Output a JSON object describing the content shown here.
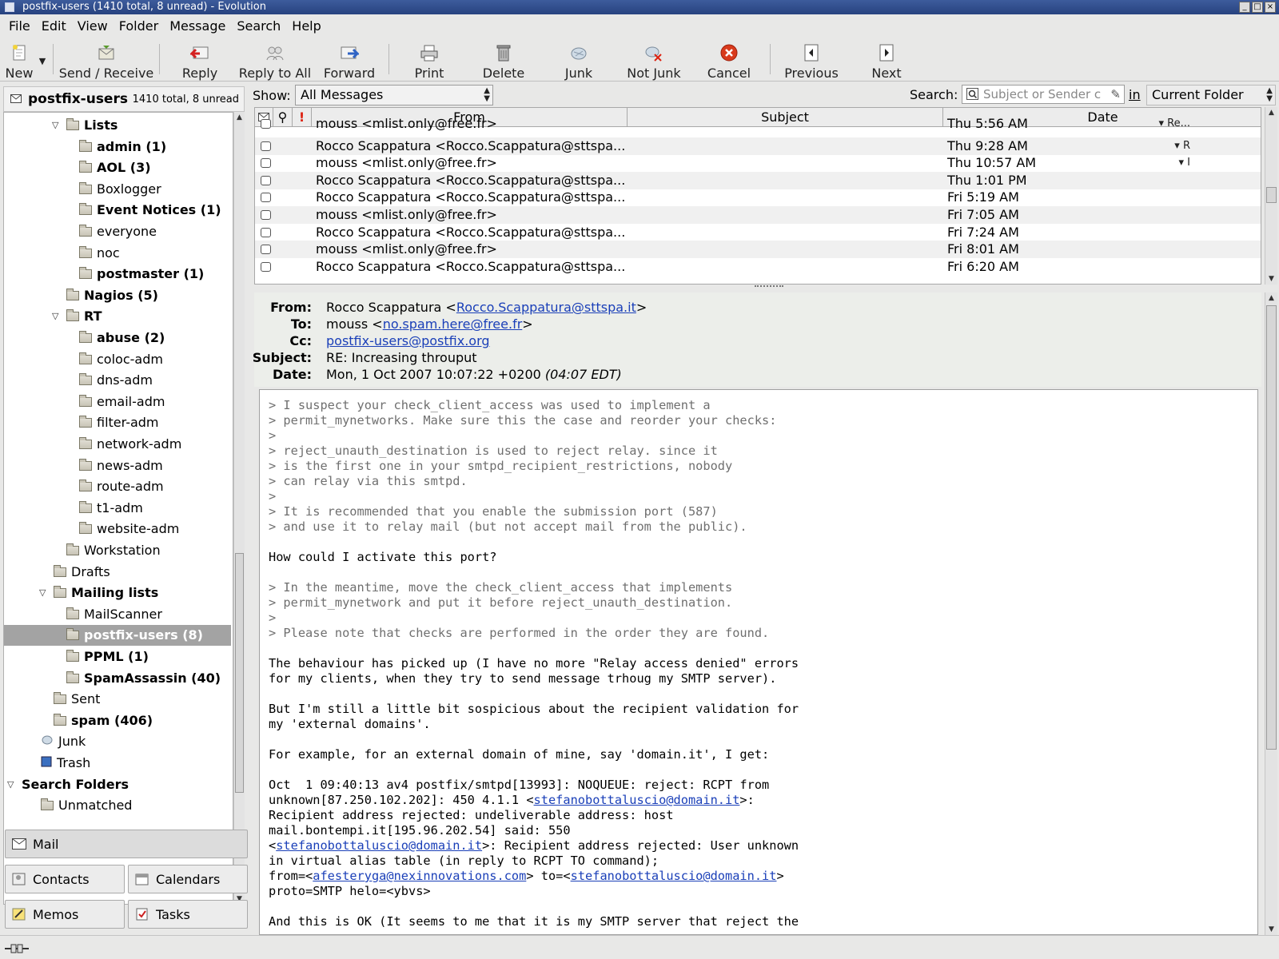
{
  "window": {
    "title": "postfix-users (1410 total, 8 unread) - Evolution"
  },
  "menu": [
    "File",
    "Edit",
    "View",
    "Folder",
    "Message",
    "Search",
    "Help"
  ],
  "toolbar": {
    "new": "New",
    "send_receive": "Send / Receive",
    "reply": "Reply",
    "reply_all": "Reply to All",
    "forward": "Forward",
    "print": "Print",
    "delete": "Delete",
    "junk": "Junk",
    "not_junk": "Not Junk",
    "cancel": "Cancel",
    "previous": "Previous",
    "next": "Next"
  },
  "account": {
    "name": "postfix-users",
    "counts": "1410 total, 8 unread"
  },
  "folders": [
    {
      "label": "Lists",
      "bold": true,
      "level": 3,
      "arrow": "open"
    },
    {
      "label": "admin (1)",
      "bold": true,
      "level": 4
    },
    {
      "label": "AOL (3)",
      "bold": true,
      "level": 4
    },
    {
      "label": "Boxlogger",
      "bold": false,
      "level": 4
    },
    {
      "label": "Event Notices (1)",
      "bold": true,
      "level": 4
    },
    {
      "label": "everyone",
      "bold": false,
      "level": 4
    },
    {
      "label": "noc",
      "bold": false,
      "level": 4
    },
    {
      "label": "postmaster (1)",
      "bold": true,
      "level": 4
    },
    {
      "label": "Nagios (5)",
      "bold": true,
      "level": 3
    },
    {
      "label": "RT",
      "bold": true,
      "level": 3,
      "arrow": "open"
    },
    {
      "label": "abuse (2)",
      "bold": true,
      "level": 4
    },
    {
      "label": "coloc-adm",
      "bold": false,
      "level": 4
    },
    {
      "label": "dns-adm",
      "bold": false,
      "level": 4
    },
    {
      "label": "email-adm",
      "bold": false,
      "level": 4
    },
    {
      "label": "filter-adm",
      "bold": false,
      "level": 4
    },
    {
      "label": "network-adm",
      "bold": false,
      "level": 4
    },
    {
      "label": "news-adm",
      "bold": false,
      "level": 4
    },
    {
      "label": "route-adm",
      "bold": false,
      "level": 4
    },
    {
      "label": "t1-adm",
      "bold": false,
      "level": 4
    },
    {
      "label": "website-adm",
      "bold": false,
      "level": 4
    },
    {
      "label": "Workstation",
      "bold": false,
      "level": 3
    },
    {
      "label": "Drafts",
      "bold": false,
      "level": 2
    },
    {
      "label": "Mailing lists",
      "bold": true,
      "level": 2,
      "arrow": "open"
    },
    {
      "label": "MailScanner",
      "bold": false,
      "level": 3
    },
    {
      "label": "postfix-users (8)",
      "bold": true,
      "level": 3,
      "selected": true
    },
    {
      "label": "PPML (1)",
      "bold": true,
      "level": 3
    },
    {
      "label": "SpamAssassin (40)",
      "bold": true,
      "level": 3
    },
    {
      "label": "Sent",
      "bold": false,
      "level": 2
    },
    {
      "label": "spam (406)",
      "bold": true,
      "level": 2
    },
    {
      "label": "Junk",
      "bold": false,
      "level": 1,
      "icon": "junk"
    },
    {
      "label": "Trash",
      "bold": false,
      "level": 1,
      "icon": "trash"
    },
    {
      "label": "Search Folders",
      "bold": true,
      "level": 0,
      "arrow": "open",
      "nofolder": true
    },
    {
      "label": "Unmatched",
      "bold": false,
      "level": 1
    }
  ],
  "switcher": {
    "mail": "Mail",
    "contacts": "Contacts",
    "calendars": "Calendars",
    "memos": "Memos",
    "tasks": "Tasks"
  },
  "filter": {
    "show_label": "Show:",
    "show_value": "All Messages",
    "search_label": "Search:",
    "search_placeholder": "Subject or Sender c",
    "in_label": "in",
    "scope": "Current Folder"
  },
  "columns": {
    "from": "From",
    "subject": "Subject",
    "date": "Date"
  },
  "messages": [
    {
      "from": "mouss <mlist.only@free.fr>",
      "subject": "Re...",
      "date": "Thu 5:56 AM"
    },
    {
      "from": "Rocco Scappatura <Rocco.Scappatura@sttspa...",
      "subject": "R",
      "date": "Thu 9:28 AM"
    },
    {
      "from": "mouss <mlist.only@free.fr>",
      "subject": "I",
      "date": "Thu 10:57 AM"
    },
    {
      "from": "Rocco Scappatura <Rocco.Scappatura@sttspa...",
      "subject": "",
      "date": "Thu 1:01 PM"
    },
    {
      "from": "Rocco Scappatura <Rocco.Scappatura@sttspa...",
      "subject": "",
      "date": "Fri 5:19 AM"
    },
    {
      "from": "mouss <mlist.only@free.fr>",
      "subject": "",
      "date": "Fri 7:05 AM"
    },
    {
      "from": "Rocco Scappatura <Rocco.Scappatura@sttspa...",
      "subject": "",
      "date": "Fri 7:24 AM"
    },
    {
      "from": "mouss <mlist.only@free.fr>",
      "subject": "",
      "date": "Fri 8:01 AM"
    },
    {
      "from": "Rocco Scappatura <Rocco.Scappatura@sttspa...",
      "subject": "",
      "date": "Fri 6:20 AM"
    }
  ],
  "preview": {
    "from_label": "From:",
    "from_name": "Rocco Scappatura <",
    "from_email": "Rocco.Scappatura@sttspa.it",
    "from_end": ">",
    "to_label": "To:",
    "to_name": "mouss <",
    "to_email": "no.spam.here@free.fr",
    "to_end": ">",
    "cc_label": "Cc:",
    "cc_email": "postfix-users@postfix.org",
    "subject_label": "Subject:",
    "subject": "RE: Increasing throuput",
    "date_label": "Date:",
    "date": "Mon, 1 Oct 2007 10:07:22 +0200",
    "date_local": "(04:07 EDT)"
  },
  "body_lines": [
    {
      "t": "> I suspect your check_client_access was used to implement a",
      "q": true
    },
    {
      "t": "> permit_mynetworks. Make sure this the case and reorder your checks:",
      "q": true
    },
    {
      "t": ">",
      "q": true
    },
    {
      "t": "> reject_unauth_destination is used to reject relay. since it",
      "q": true
    },
    {
      "t": "> is the first one in your smtpd_recipient_restrictions, nobody",
      "q": true
    },
    {
      "t": "> can relay via this smtpd.",
      "q": true
    },
    {
      "t": ">",
      "q": true
    },
    {
      "t": "> It is recommended that you enable the submission port (587)",
      "q": true
    },
    {
      "t": "> and use it to relay mail (but not accept mail from the public).",
      "q": true
    },
    {
      "t": ""
    },
    {
      "t": "How could I activate this port?"
    },
    {
      "t": ""
    },
    {
      "t": "> In the meantime, move the check_client_access that implements",
      "q": true
    },
    {
      "t": "> permit_mynetwork and put it before reject_unauth_destination.",
      "q": true
    },
    {
      "t": ">",
      "q": true
    },
    {
      "t": "> Please note that checks are performed in the order they are found.",
      "q": true
    },
    {
      "t": ""
    },
    {
      "t": "The behaviour has picked up (I have no more \"Relay access denied\" errors"
    },
    {
      "t": "for my clients, when they try to send message trhoug my SMTP server)."
    },
    {
      "t": ""
    },
    {
      "t": "But I'm still a little bit sospicious about the recipient validation for"
    },
    {
      "t": "my 'external domains'."
    },
    {
      "t": ""
    },
    {
      "t": "For example, for an external domain of mine, say 'domain.it', I get:"
    },
    {
      "t": ""
    },
    {
      "t": "Oct  1 09:40:13 av4 postfix/smtpd[13993]: NOQUEUE: reject: RCPT from"
    },
    {
      "pre": "unknown[87.250.102.202]: 450 4.1.1 <",
      "link": "stefanobottaluscio@domain.it",
      "post": ">:"
    },
    {
      "t": "Recipient address rejected: undeliverable address: host"
    },
    {
      "t": "mail.bontempi.it[195.96.202.54] said: 550"
    },
    {
      "pre": "<",
      "link": "stefanobottaluscio@domain.it",
      "post": ">: Recipient address rejected: User unknown"
    },
    {
      "t": "in virtual alias table (in reply to RCPT TO command);"
    },
    {
      "pre": "from=<",
      "link": "afesteryga@nexinnovations.com",
      "mid": "> to=<",
      "link2": "stefanobottaluscio@domain.it",
      "post": ">"
    },
    {
      "t": "proto=SMTP helo=<ybvs>"
    },
    {
      "t": ""
    },
    {
      "t": "And this is OK (It seems to me that it is my SMTP server that reject the"
    }
  ]
}
